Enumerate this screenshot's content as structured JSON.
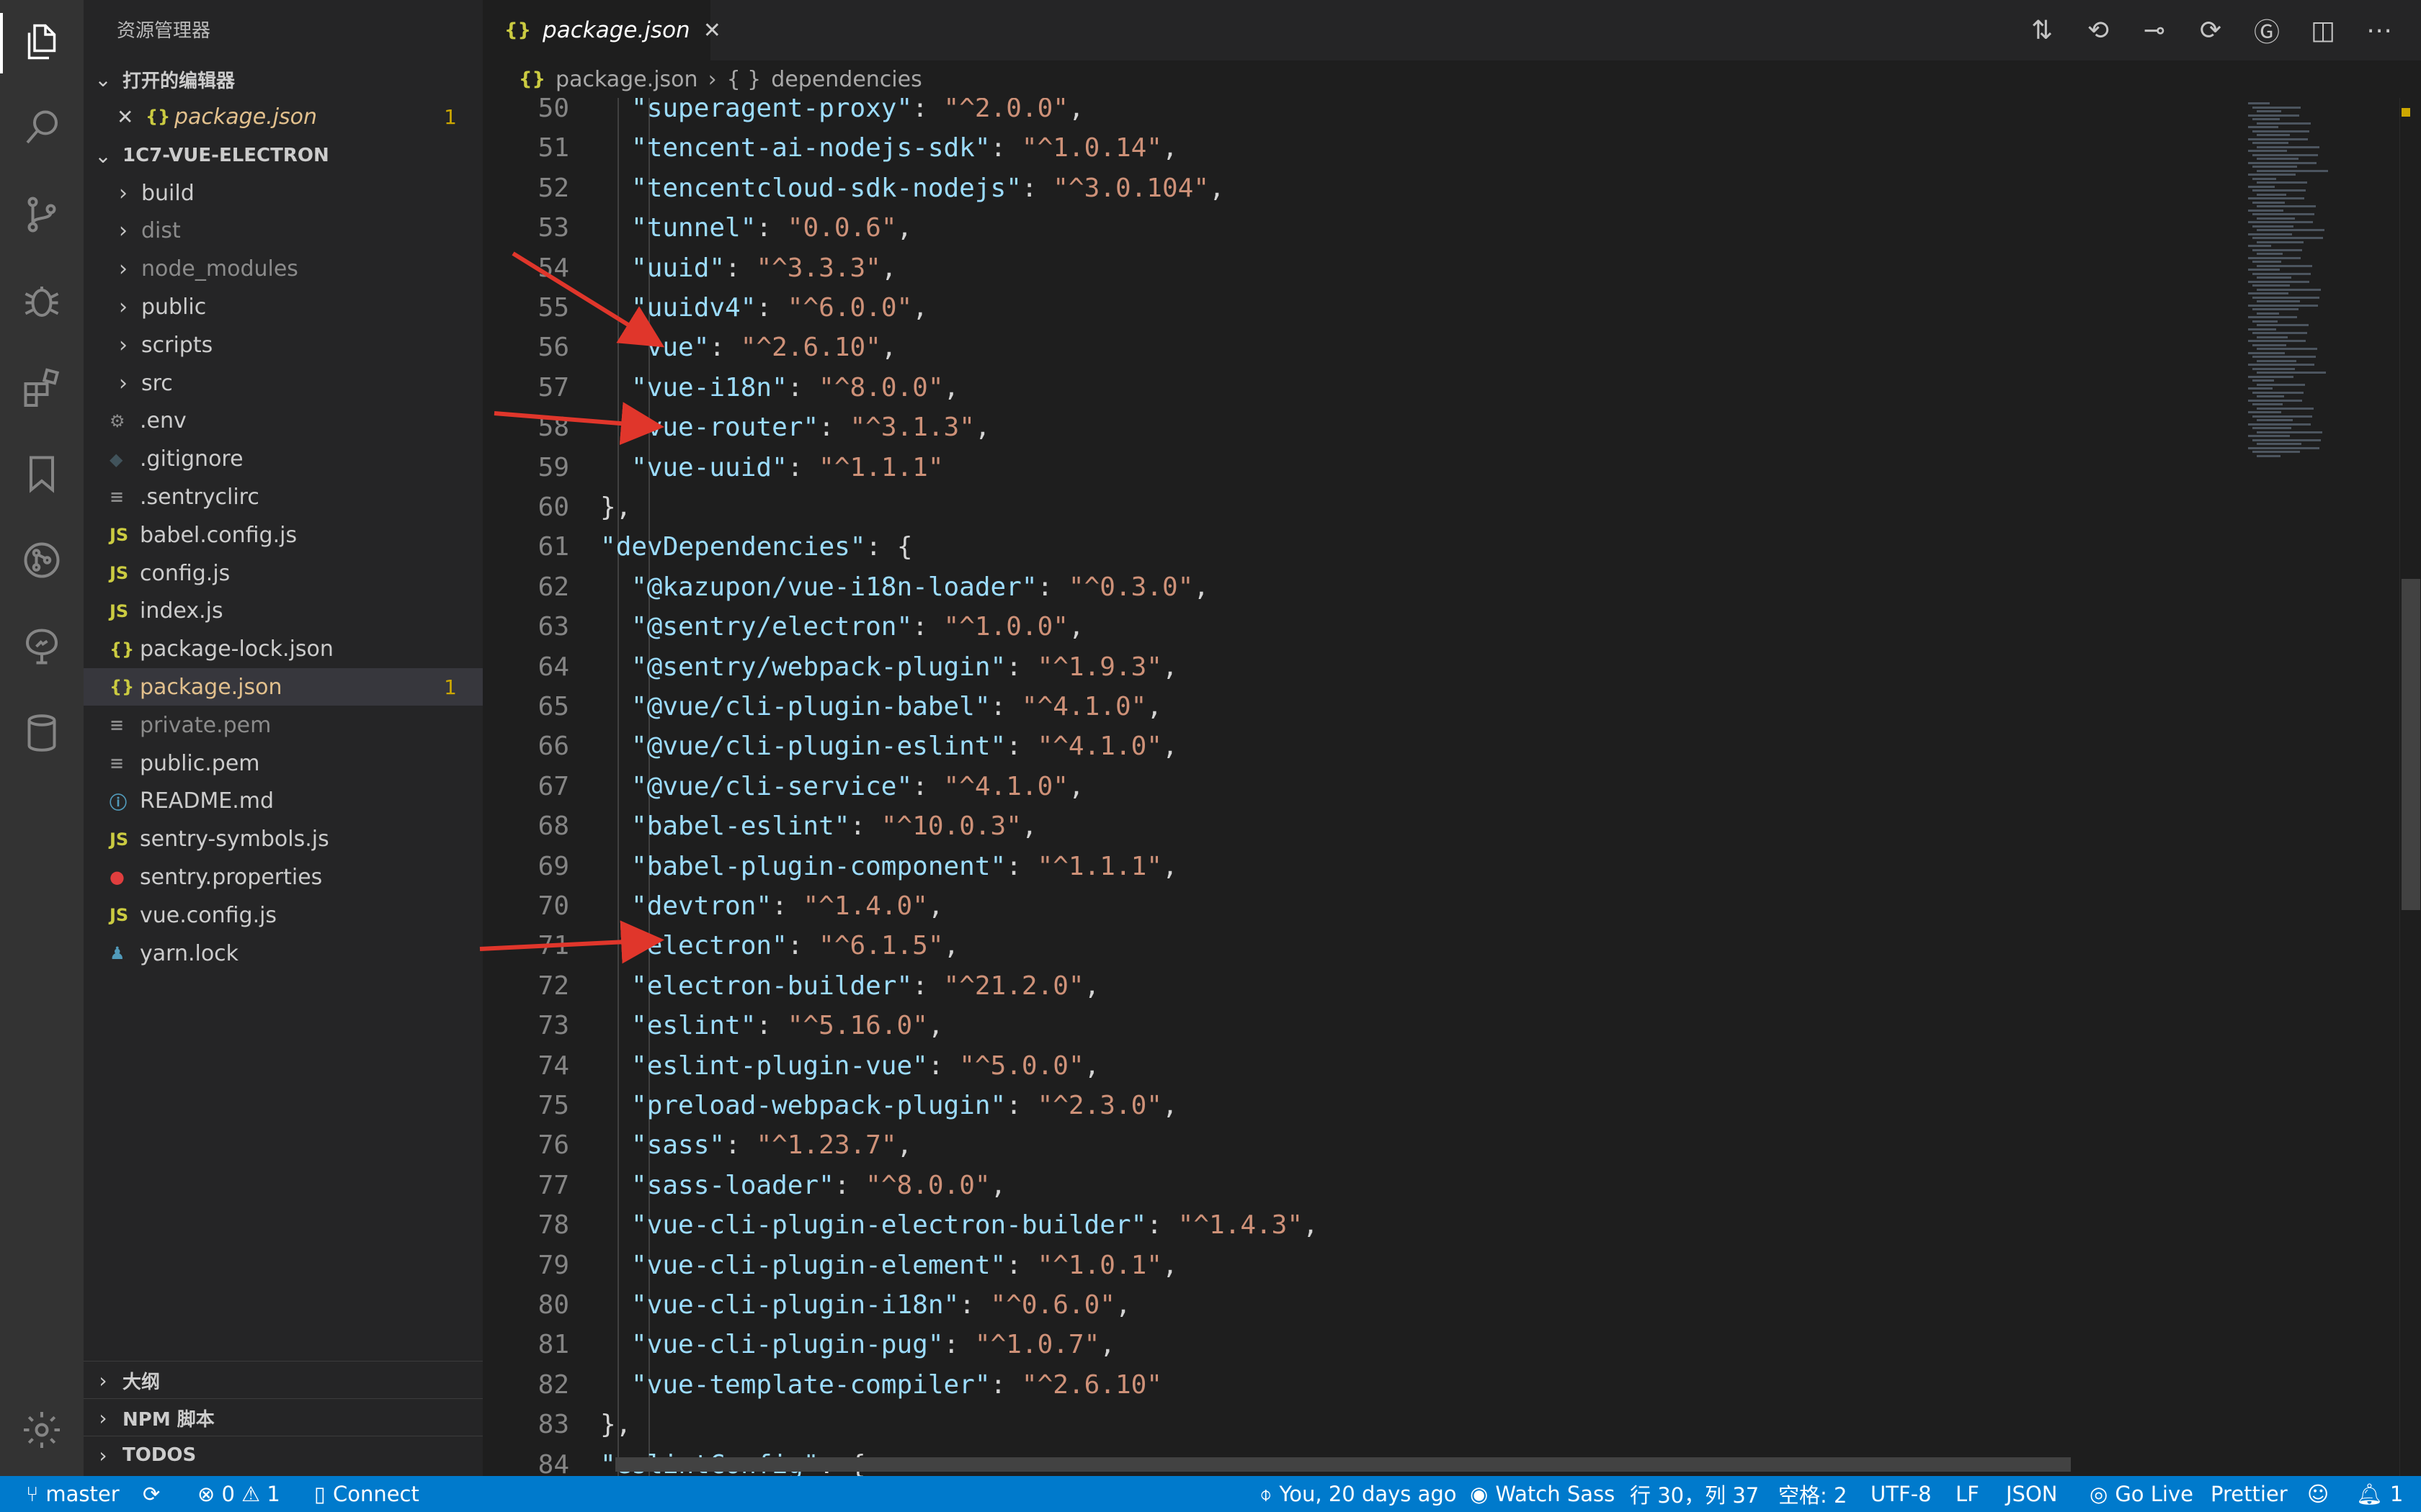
{
  "sidebar": {
    "title": "资源管理器",
    "open_editors_header": "打开的编辑器",
    "open_editor": {
      "icon": "{}",
      "close": "✕",
      "name": "package.json",
      "badge": "1"
    },
    "project_header": "1C7-VUE-ELECTRON",
    "files": [
      {
        "name": "build",
        "type": "folder",
        "icon": ""
      },
      {
        "name": "dist",
        "type": "folder",
        "icon": "",
        "dim": true
      },
      {
        "name": "node_modules",
        "type": "folder",
        "icon": "",
        "dim": true
      },
      {
        "name": "public",
        "type": "folder",
        "icon": ""
      },
      {
        "name": "scripts",
        "type": "folder",
        "icon": ""
      },
      {
        "name": "src",
        "type": "folder",
        "icon": ""
      },
      {
        "name": ".env",
        "type": "file",
        "icon": "⚙",
        "color": "#8b8b8b"
      },
      {
        "name": ".gitignore",
        "type": "file",
        "icon": "◆",
        "color": "#41535b"
      },
      {
        "name": ".sentryclirc",
        "type": "file",
        "icon": "≡",
        "color": "#8b8b8b"
      },
      {
        "name": "babel.config.js",
        "type": "file",
        "icon": "JS",
        "color": "#cbcb41"
      },
      {
        "name": "config.js",
        "type": "file",
        "icon": "JS",
        "color": "#cbcb41"
      },
      {
        "name": "index.js",
        "type": "file",
        "icon": "JS",
        "color": "#cbcb41"
      },
      {
        "name": "package-lock.json",
        "type": "file",
        "icon": "{}",
        "color": "#cbcb41"
      },
      {
        "name": "package.json",
        "type": "file",
        "icon": "{}",
        "color": "#cbcb41",
        "selected": true,
        "badge": "1"
      },
      {
        "name": "private.pem",
        "type": "file",
        "icon": "≡",
        "color": "#8b8b8b",
        "dim": true
      },
      {
        "name": "public.pem",
        "type": "file",
        "icon": "≡",
        "color": "#8b8b8b"
      },
      {
        "name": "README.md",
        "type": "file",
        "icon": "ⓘ",
        "color": "#519aba"
      },
      {
        "name": "sentry-symbols.js",
        "type": "file",
        "icon": "JS",
        "color": "#cbcb41"
      },
      {
        "name": "sentry.properties",
        "type": "file",
        "icon": "●",
        "color": "#e03e3e"
      },
      {
        "name": "vue.config.js",
        "type": "file",
        "icon": "JS",
        "color": "#cbcb41"
      },
      {
        "name": "yarn.lock",
        "type": "file",
        "icon": "♟",
        "color": "#519aba"
      }
    ],
    "bottom_sections": [
      "大纲",
      "NPM 脚本",
      "TODOS"
    ]
  },
  "tab": {
    "icon": "{}",
    "label": "package.json",
    "close": "✕"
  },
  "editor_actions": [
    "⇅",
    "⟲",
    "⊸",
    "⟳",
    "Ⓖ",
    "◫",
    "⋯"
  ],
  "breadcrumb": {
    "icon": "{}",
    "file": "package.json",
    "sep": "›",
    "sym_icon": "{ }",
    "symbol": "dependencies"
  },
  "code_lines": [
    {
      "n": "50",
      "indent": 2,
      "key": "superagent-proxy",
      "val": "^2.0.0",
      "tail": ","
    },
    {
      "n": "51",
      "indent": 2,
      "key": "tencent-ai-nodejs-sdk",
      "val": "^1.0.14",
      "tail": ","
    },
    {
      "n": "52",
      "indent": 2,
      "key": "tencentcloud-sdk-nodejs",
      "val": "^3.0.104",
      "tail": ","
    },
    {
      "n": "53",
      "indent": 2,
      "key": "tunnel",
      "val": "0.0.6",
      "tail": ","
    },
    {
      "n": "54",
      "indent": 2,
      "key": "uuid",
      "val": "^3.3.3",
      "tail": ","
    },
    {
      "n": "55",
      "indent": 2,
      "key": "uuidv4",
      "val": "^6.0.0",
      "tail": ","
    },
    {
      "n": "56",
      "indent": 2,
      "key": "vue",
      "val": "^2.6.10",
      "tail": ","
    },
    {
      "n": "57",
      "indent": 2,
      "key": "vue-i18n",
      "val": "^8.0.0",
      "tail": ","
    },
    {
      "n": "58",
      "indent": 2,
      "key": "vue-router",
      "val": "^3.1.3",
      "tail": ","
    },
    {
      "n": "59",
      "indent": 2,
      "key": "vue-uuid",
      "val": "^1.1.1",
      "tail": ""
    },
    {
      "n": "60",
      "indent": 1,
      "raw": "},"
    },
    {
      "n": "61",
      "indent": 1,
      "key": "devDependencies",
      "raw_tail": ": {"
    },
    {
      "n": "62",
      "indent": 2,
      "key": "@kazupon/vue-i18n-loader",
      "val": "^0.3.0",
      "tail": ","
    },
    {
      "n": "63",
      "indent": 2,
      "key": "@sentry/electron",
      "val": "^1.0.0",
      "tail": ","
    },
    {
      "n": "64",
      "indent": 2,
      "key": "@sentry/webpack-plugin",
      "val": "^1.9.3",
      "tail": ","
    },
    {
      "n": "65",
      "indent": 2,
      "key": "@vue/cli-plugin-babel",
      "val": "^4.1.0",
      "tail": ","
    },
    {
      "n": "66",
      "indent": 2,
      "key": "@vue/cli-plugin-eslint",
      "val": "^4.1.0",
      "tail": ","
    },
    {
      "n": "67",
      "indent": 2,
      "key": "@vue/cli-service",
      "val": "^4.1.0",
      "tail": ","
    },
    {
      "n": "68",
      "indent": 2,
      "key": "babel-eslint",
      "val": "^10.0.3",
      "tail": ","
    },
    {
      "n": "69",
      "indent": 2,
      "key": "babel-plugin-component",
      "val": "^1.1.1",
      "tail": ","
    },
    {
      "n": "70",
      "indent": 2,
      "key": "devtron",
      "val": "^1.4.0",
      "tail": ","
    },
    {
      "n": "71",
      "indent": 2,
      "key": "electron",
      "val": "^6.1.5",
      "tail": ","
    },
    {
      "n": "72",
      "indent": 2,
      "key": "electron-builder",
      "val": "^21.2.0",
      "tail": ","
    },
    {
      "n": "73",
      "indent": 2,
      "key": "eslint",
      "val": "^5.16.0",
      "tail": ","
    },
    {
      "n": "74",
      "indent": 2,
      "key": "eslint-plugin-vue",
      "val": "^5.0.0",
      "tail": ","
    },
    {
      "n": "75",
      "indent": 2,
      "key": "preload-webpack-plugin",
      "val": "^2.3.0",
      "tail": ","
    },
    {
      "n": "76",
      "indent": 2,
      "key": "sass",
      "val": "^1.23.7",
      "tail": ","
    },
    {
      "n": "77",
      "indent": 2,
      "key": "sass-loader",
      "val": "^8.0.0",
      "tail": ","
    },
    {
      "n": "78",
      "indent": 2,
      "key": "vue-cli-plugin-electron-builder",
      "val": "^1.4.3",
      "tail": ","
    },
    {
      "n": "79",
      "indent": 2,
      "key": "vue-cli-plugin-element",
      "val": "^1.0.1",
      "tail": ","
    },
    {
      "n": "80",
      "indent": 2,
      "key": "vue-cli-plugin-i18n",
      "val": "^0.6.0",
      "tail": ","
    },
    {
      "n": "81",
      "indent": 2,
      "key": "vue-cli-plugin-pug",
      "val": "^1.0.7",
      "tail": ","
    },
    {
      "n": "82",
      "indent": 2,
      "key": "vue-template-compiler",
      "val": "^2.6.10",
      "tail": ""
    },
    {
      "n": "83",
      "indent": 1,
      "raw": "},"
    },
    {
      "n": "84",
      "indent": 1,
      "key": "eslintConfig",
      "raw_tail": ": {"
    }
  ],
  "status": {
    "branch": "master",
    "sync_icon": "⟳",
    "problems": "⊗ 0 ⚠ 1",
    "connect": "Connect",
    "blame": "You, 20 days ago",
    "sass": "Watch Sass",
    "position": "行 30，列 37",
    "spaces": "空格: 2",
    "encoding": "UTF-8",
    "eol": "LF",
    "lang": "JSON",
    "golive": "Go Live",
    "prettier": "Prettier",
    "feedback": "☺",
    "notifications": "1"
  },
  "colors": {
    "accent": "#007acc",
    "arrow": "#e0362b",
    "warning": "#cca700"
  }
}
